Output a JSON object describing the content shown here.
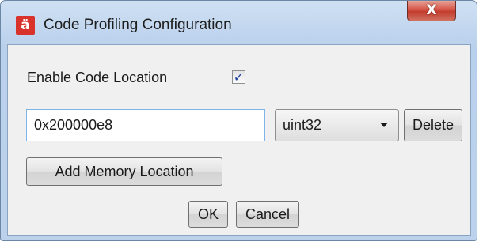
{
  "window": {
    "title": "Code Profiling Configuration",
    "app_icon": "ä",
    "close_glyph": "X"
  },
  "form": {
    "enable_label": "Enable Code Location",
    "enable_checked": true,
    "checkbox_glyph": "✓",
    "address_value": "0x200000e8",
    "type_selected": "uint32",
    "delete_label": "Delete",
    "add_label": "Add Memory Location",
    "ok_label": "OK",
    "cancel_label": "Cancel"
  }
}
